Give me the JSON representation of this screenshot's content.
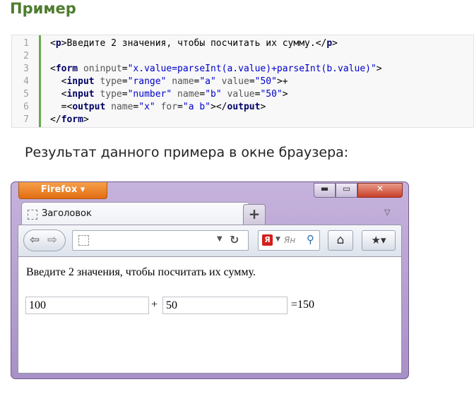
{
  "page": {
    "heading": "Пример",
    "result_caption": "Результат данного примера в окне браузера:"
  },
  "code": {
    "lines": [
      "1",
      "2",
      "3",
      "4",
      "5",
      "6",
      "7"
    ]
  },
  "browser": {
    "menu_button": "Firefox ▾",
    "tab_title": "Заголовок",
    "new_tab": "+",
    "search_engine_label": "Ян",
    "window_controls": {
      "minimize": "▬",
      "maximize": "▭",
      "close": "✕"
    },
    "icons": [
      "back-arrow-icon",
      "forward-arrow-icon",
      "reload-icon",
      "search-icon",
      "home-icon",
      "bookmarks-icon"
    ]
  },
  "content": {
    "paragraph": "Введите 2 значения, чтобы посчитать их сумму.",
    "input_a": "100",
    "plus": "+",
    "input_b": "50",
    "output": "=150"
  }
}
